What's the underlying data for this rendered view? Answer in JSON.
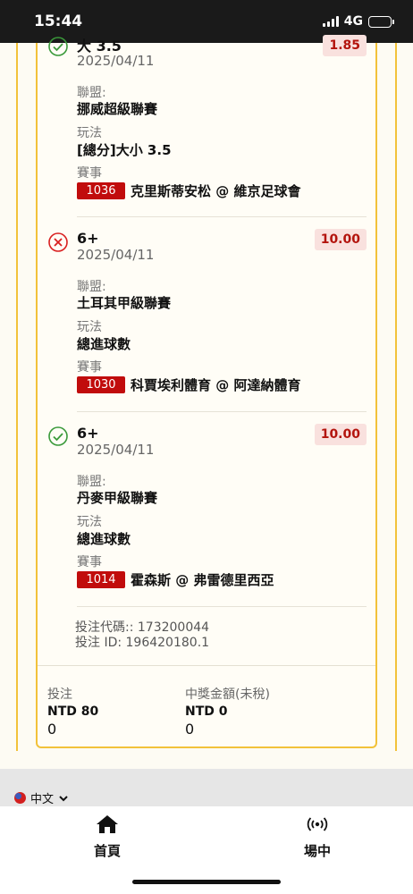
{
  "status_bar": {
    "time": "15:44",
    "network": "4G",
    "signal_icon": "cellular-signal-icon",
    "battery_icon": "battery-icon"
  },
  "selections": [
    {
      "status": "won",
      "status_icon": "check-circle-icon",
      "name": "大 3.5",
      "date": "2025/04/11",
      "odds": "1.85",
      "league_label": "聯盟:",
      "league": "挪威超級聯賽",
      "play_label": "玩法",
      "play": "[總分]大小 3.5",
      "event_label": "賽事",
      "event_code": "1036",
      "event": "克里斯蒂安松 @ 維京足球會"
    },
    {
      "status": "lost",
      "status_icon": "cross-circle-icon",
      "name": "6+",
      "date": "2025/04/11",
      "odds": "10.00",
      "league_label": "聯盟:",
      "league": "土耳其甲級聯賽",
      "play_label": "玩法",
      "play": "總進球數",
      "event_label": "賽事",
      "event_code": "1030",
      "event": "科賈埃利體育 @ 阿達納體育"
    },
    {
      "status": "won",
      "status_icon": "check-circle-icon",
      "name": "6+",
      "date": "2025/04/11",
      "odds": "10.00",
      "league_label": "聯盟:",
      "league": "丹麥甲級聯賽",
      "play_label": "玩法",
      "play": "總進球數",
      "event_label": "賽事",
      "event_code": "1014",
      "event": "霍森斯 @ 弗雷德里西亞"
    }
  ],
  "bet_codes": {
    "bet_code": "投注代碼:: 173200044",
    "bet_id": "投注 ID: 196420180.1"
  },
  "summary": {
    "stake_label": "投注",
    "stake_value": "NTD 80",
    "stake_sub": "0",
    "win_label": "中獎金額(未稅)",
    "win_value": "NTD 0",
    "win_sub": "0"
  },
  "footer": {
    "language": "中文",
    "language_icon": "taiwan-flag-icon",
    "chevron_icon": "chevron-down-icon"
  },
  "bottom_nav": [
    {
      "label": "首頁",
      "icon": "home-icon"
    },
    {
      "label": "場中",
      "icon": "live-broadcast-icon"
    }
  ],
  "colors": {
    "accent_border": "#f2c23a",
    "odds_text": "#b3140d",
    "odds_bg": "#f9e1de",
    "event_code_bg": "#c10c0c",
    "win_icon": "#3a9a3a",
    "loss_icon": "#d92020"
  }
}
